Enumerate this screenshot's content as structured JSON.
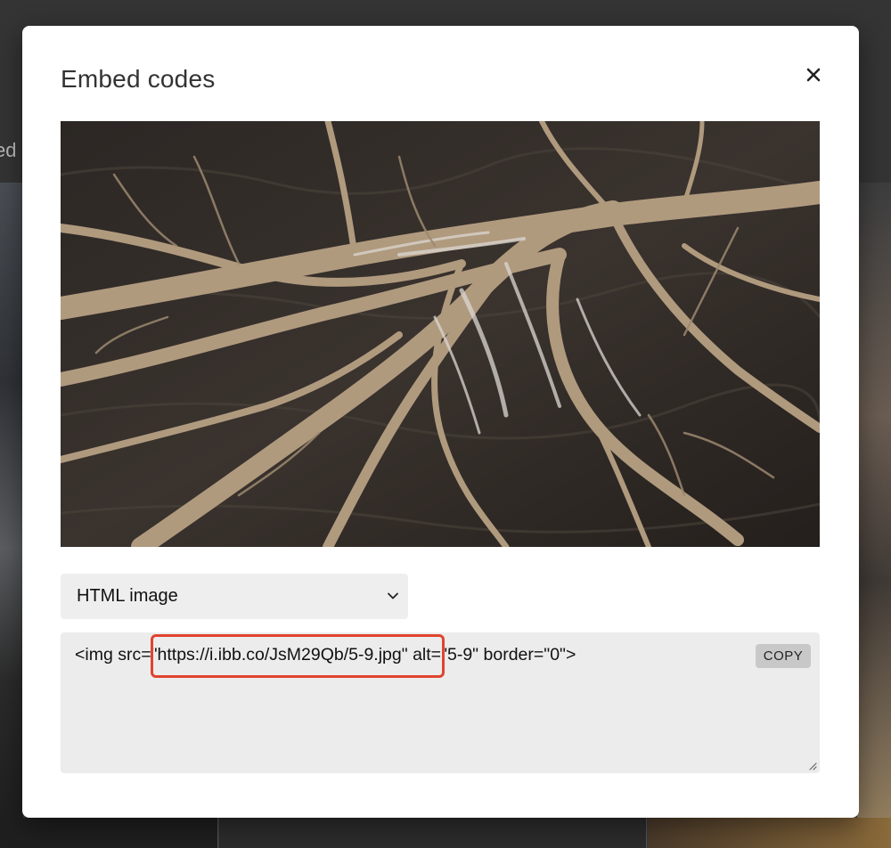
{
  "background": {
    "partial_text": "ed"
  },
  "modal": {
    "title": "Embed codes",
    "close_icon": "close-icon",
    "preview_alt": "aerial river delta photo",
    "format_select": {
      "selected": "HTML image",
      "chevron_icon": "chevron-down-icon"
    },
    "code": {
      "value": "<img src=\"https://i.ibb.co/JsM29Qb/5-9.jpg\" alt=\"5-9\" border=\"0\">",
      "highlight_color": "#e0442e"
    },
    "copy_label": "COPY"
  }
}
